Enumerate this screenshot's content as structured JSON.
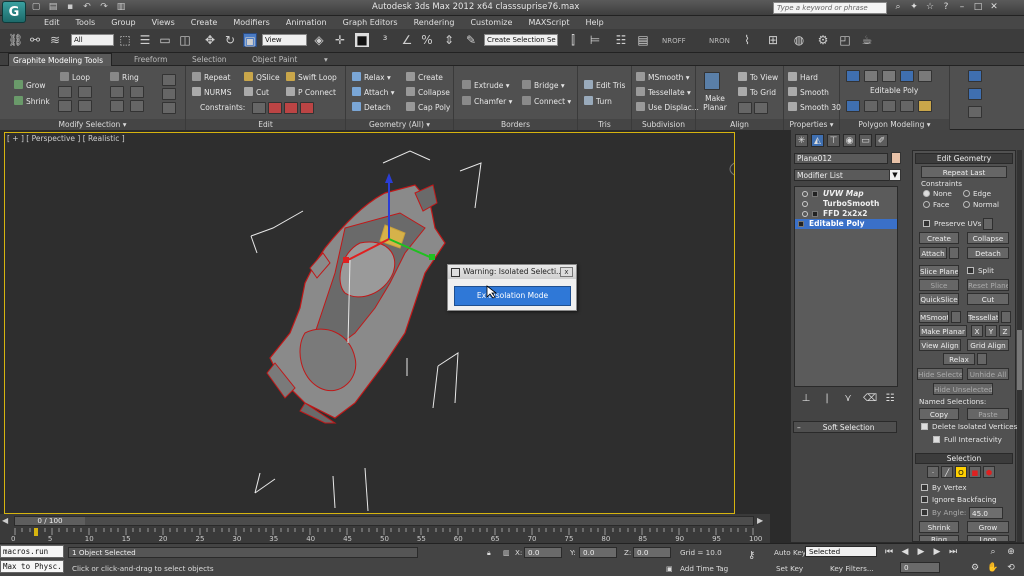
{
  "app": {
    "logo": "G",
    "window_title": "Autodesk 3ds Max  2012 x64      classsuprise76.max",
    "search_placeholder": "Type a keyword or phrase"
  },
  "menus": [
    "Edit",
    "Tools",
    "Group",
    "Views",
    "Create",
    "Modifiers",
    "Animation",
    "Graph Editors",
    "Rendering",
    "Customize",
    "MAXScript",
    "Help"
  ],
  "toolbar": {
    "filter_dropdown": "All",
    "view_dropdown": "View",
    "selection_set": "Create Selection Se",
    "nroff": "NROFF",
    "nron": "NRON"
  },
  "ribbon": {
    "tabs": [
      "Graphite Modeling Tools",
      "Freeform",
      "Selection",
      "Object Paint"
    ],
    "panels": {
      "modify_selection": {
        "footer": "Modify Selection",
        "items": [
          "Grow",
          "Shrink",
          "Loop",
          "Ring"
        ]
      },
      "edit": {
        "footer": "Edit",
        "items": [
          "Repeat",
          "QSlice",
          "Swift Loop",
          "NURMS",
          "Cut",
          "P Connect",
          "Constraints:"
        ]
      },
      "geometry": {
        "footer": "Geometry (All)",
        "items": [
          "Relax",
          "Create",
          "Attach",
          "Collapse",
          "Detach",
          "Cap Poly"
        ]
      },
      "borders": {
        "footer": "Borders",
        "items": [
          "Extrude",
          "Bridge",
          "Chamfer",
          "Connect"
        ]
      },
      "tris": {
        "footer": "Tris",
        "items": [
          "Edit Tris",
          "Turn"
        ]
      },
      "subdivision": {
        "footer": "Subdivision",
        "items": [
          "MSmooth",
          "Tessellate",
          "Use Displac..."
        ]
      },
      "align": {
        "footer": "Align",
        "items": [
          "Make Planar",
          "To View",
          "To Grid"
        ]
      },
      "properties": {
        "footer": "Properties",
        "items": [
          "Hard",
          "Smooth",
          "Smooth 30"
        ]
      },
      "polygon_modeling": {
        "footer": "Polygon Modeling",
        "label": "Editable Poly"
      }
    }
  },
  "viewport": {
    "label": "[ + ] [ Perspective ] [ Realistic ]",
    "border_color": "#d6b40f"
  },
  "dialog": {
    "title": "Warning: Isolated Selecti...",
    "close": "x",
    "button": "Exit Isolation Mode"
  },
  "command_panel": {
    "object_name": "Plane012",
    "modifier_list": "Modifier List",
    "stack": [
      "UVW Map",
      "TurboSmooth",
      "FFD 2x2x2",
      "Editable Poly"
    ],
    "soft_selection": "Soft Selection",
    "edit_geometry": {
      "title": "Edit Geometry",
      "repeat_last": "Repeat Last",
      "constraints_label": "Constraints",
      "constraint_options": [
        "None",
        "Edge",
        "Face",
        "Normal"
      ],
      "preserve_uvs": "Preserve UVs",
      "create": "Create",
      "collapse": "Collapse",
      "attach": "Attach",
      "detach": "Detach",
      "slice_plane": "Slice Plane",
      "split": "Split",
      "slice": "Slice",
      "reset_plane": "Reset Plane",
      "quickslice": "QuickSlice",
      "cut": "Cut",
      "msmooth": "MSmooth",
      "tessellate": "Tessellate",
      "make_planar": "Make Planar",
      "x": "X",
      "y": "Y",
      "z": "Z",
      "view_align": "View Align",
      "grid_align": "Grid Align",
      "relax": "Relax",
      "hide_selected": "Hide Selected",
      "unhide_all": "Unhide All",
      "hide_unselected": "Hide Unselected",
      "named_selections": "Named Selections:",
      "copy": "Copy",
      "paste": "Paste",
      "delete_isolated": "Delete Isolated Vertices",
      "full_interactivity": "Full Interactivity"
    },
    "selection": {
      "title": "Selection",
      "by_vertex": "By Vertex",
      "ignore_backfacing": "Ignore Backfacing",
      "by_angle": "By Angle:",
      "angle_value": "45.0",
      "shrink": "Shrink",
      "grow": "Grow",
      "ring": "Ring",
      "loop": "Loop"
    }
  },
  "timeline": {
    "slider": "0 / 100",
    "ticks": [
      "0",
      "5",
      "10",
      "15",
      "20",
      "25",
      "30",
      "35",
      "40",
      "45",
      "50",
      "55",
      "60",
      "65",
      "70",
      "75",
      "80",
      "85",
      "90",
      "95",
      "100"
    ]
  },
  "status": {
    "macro1": "macros.run",
    "macro2": "Max to Physc.",
    "selected": "1 Object Selected",
    "prompt": "Click or click-and-drag to select objects",
    "x_label": "X:",
    "x_value": "0.0",
    "y_label": "Y:",
    "y_value": "0.0",
    "z_label": "Z:",
    "z_value": "0.0",
    "grid": "Grid = 10.0",
    "add_time_tag": "Add Time Tag",
    "auto_key": "Auto Key",
    "set_key": "Set Key",
    "key_mode": "Selected",
    "key_filters": "Key Filters...",
    "frame": "0"
  }
}
